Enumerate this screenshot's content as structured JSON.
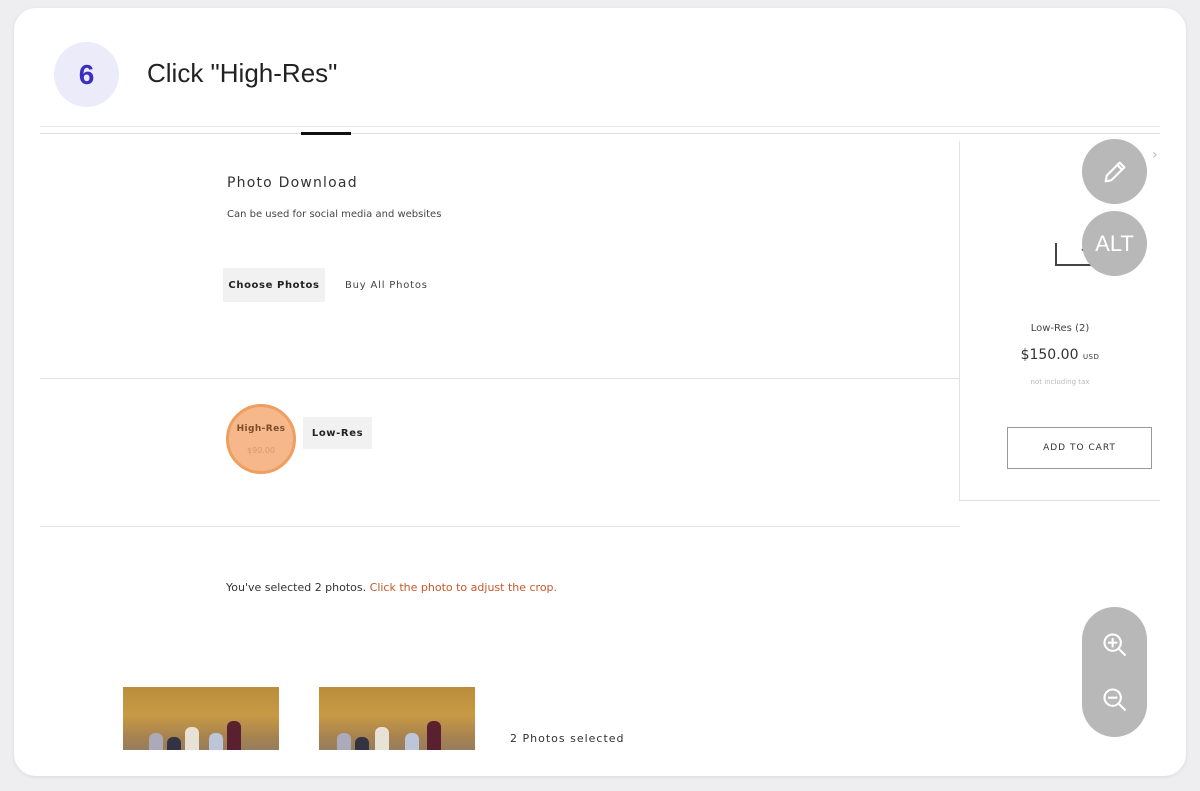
{
  "step": {
    "number": "6",
    "instruction": "Click \"High-Res\""
  },
  "product": {
    "title": "Photo Download",
    "description": "Can be used for social media and websites",
    "choose_label": "Choose Photos",
    "buy_all_label": "Buy All Photos"
  },
  "options": [
    {
      "label": "High-Res",
      "price": "$90.00"
    },
    {
      "label": "Low-Res"
    }
  ],
  "selection": {
    "text": "You've selected 2 photos.",
    "hint": "Click the photo to adjust the crop.",
    "count_label": "2 Photos selected"
  },
  "cart": {
    "item": "Low-Res (2)",
    "price": "$150.00",
    "currency": "USD",
    "tax_note": "not including tax",
    "add_label": "ADD TO CART"
  },
  "overlay": {
    "alt_label": "ALT"
  },
  "colors": {
    "accent": "#c8562a",
    "highlight": "#f6b78a",
    "step_text": "#3b2fc2"
  }
}
